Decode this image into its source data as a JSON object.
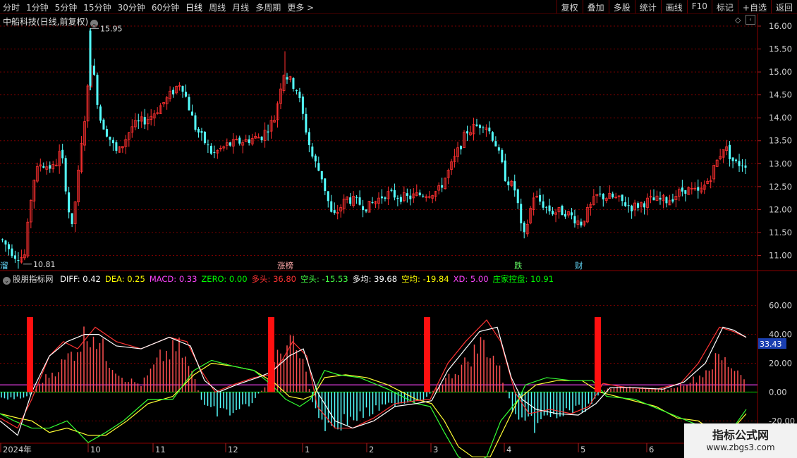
{
  "toolbar": {
    "periods": [
      "分时",
      "1分钟",
      "5分钟",
      "15分钟",
      "30分钟",
      "60分钟",
      "日线",
      "周线",
      "月线",
      "多周期",
      "更多 >"
    ],
    "active_period": "日线",
    "right_buttons": [
      "复权",
      "叠加",
      "多股",
      "统计",
      "画线",
      "F10",
      "标记",
      "+自选",
      "返回"
    ]
  },
  "stock": {
    "title": "中船科技(日线,前复权)"
  },
  "price_axis": {
    "ticks": [
      "16.00",
      "15.50",
      "15.00",
      "14.50",
      "14.00",
      "13.50",
      "13.00",
      "12.50",
      "12.00",
      "11.50",
      "11.00"
    ]
  },
  "price_annotations": {
    "high": "15.95",
    "low": "10.81"
  },
  "signal_tags": [
    {
      "text": "溜",
      "color": "#66ddff"
    },
    {
      "text": "涨榜",
      "color": "#ffaaaa"
    },
    {
      "text": "跌",
      "color": "#66ff66"
    },
    {
      "text": "财",
      "color": "#66ddff"
    }
  ],
  "indicator": {
    "name": "股朋指标网",
    "items": [
      {
        "label": "DIFF: 0.42",
        "color": "#ffffff"
      },
      {
        "label": "DEA: 0.25",
        "color": "#ffff00"
      },
      {
        "label": "MACD: 0.33",
        "color": "#ff44ff"
      },
      {
        "label": "ZERO: 0.00",
        "color": "#00ff00"
      },
      {
        "label": "多头: 36.80",
        "color": "#ff3333"
      },
      {
        "label": "空头: -15.53",
        "color": "#44ff44"
      },
      {
        "label": "多均: 39.68",
        "color": "#ffffff"
      },
      {
        "label": "空均: -19.84",
        "color": "#ffff00"
      },
      {
        "label": "XD: 5.00",
        "color": "#ff44ff"
      },
      {
        "label": "庄家控盘: 10.91",
        "color": "#00ff00"
      }
    ]
  },
  "ind_axis": {
    "ticks": [
      "60.00",
      "40.00",
      "20.00",
      "0.00",
      "-20.00"
    ],
    "current": "33.43"
  },
  "date_axis": {
    "labels": [
      "2024年",
      "10",
      "11",
      "12",
      "1",
      "2",
      "3",
      "4",
      "5",
      "6"
    ]
  },
  "watermark": {
    "main": "指标公式网",
    "sub": "www.zbgs3.com"
  },
  "chart_data": {
    "type": "candlestick",
    "price_range": [
      10.7,
      16.2
    ],
    "indicator_range": [
      -35,
      75
    ],
    "candles": [],
    "bull_bear": {
      "bull": [],
      "bear": [],
      "bull_avg": [],
      "bear_avg": [],
      "macd_hist": [],
      "signals_red": [
        38,
        380,
        601,
        843
      ],
      "xd_level": 5.0
    }
  }
}
